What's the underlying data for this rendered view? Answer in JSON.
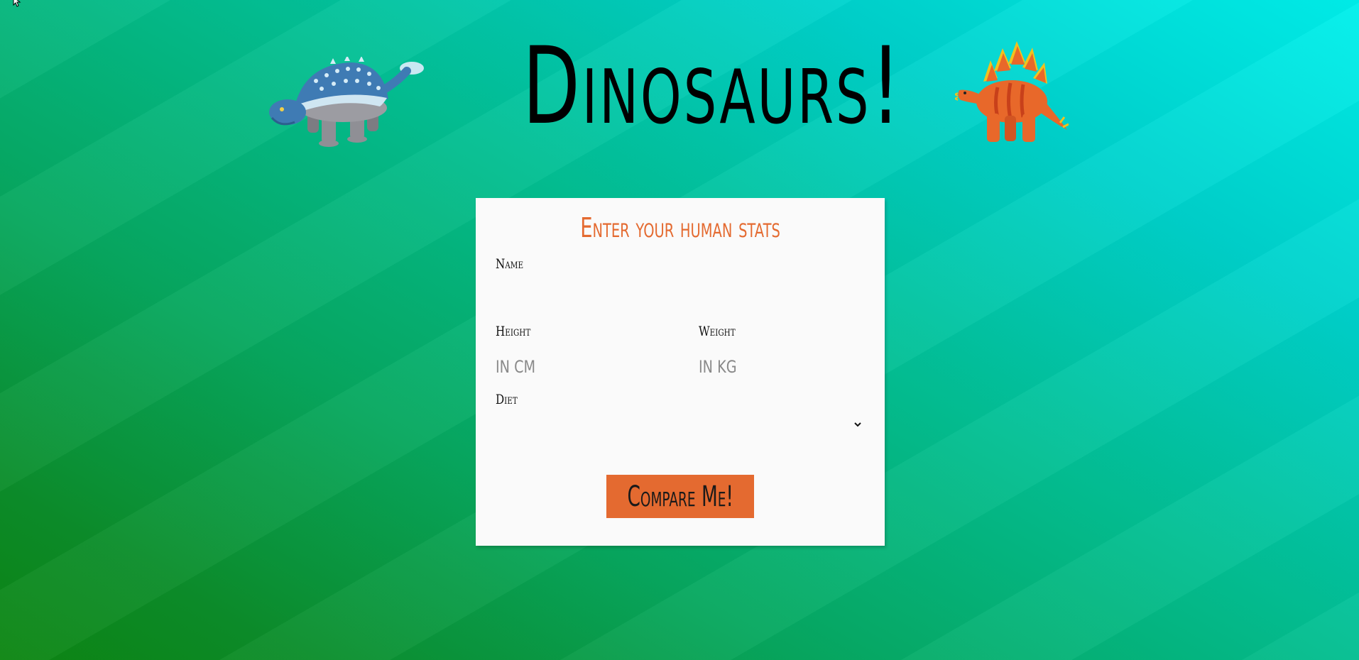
{
  "page": {
    "title": "Dinosaurs!"
  },
  "form": {
    "heading": "Enter your human stats",
    "name": {
      "label": "Name",
      "value": "",
      "placeholder": ""
    },
    "height": {
      "label": "Height",
      "value": "",
      "placeholder": "IN CM"
    },
    "weight": {
      "label": "Weight",
      "value": "",
      "placeholder": "IN KG"
    },
    "diet": {
      "label": "Diet",
      "selected": ""
    },
    "submit_label": "Compare Me!"
  },
  "icons": {
    "left_dinosaur": "ankylosaurus-icon",
    "right_dinosaur": "stegosaurus-icon",
    "select_arrow": "chevron-down-icon",
    "cursor": "mouse-cursor-icon"
  },
  "colors": {
    "accent": "#e46a30",
    "card_background": "#fafafa",
    "title_text": "#000000",
    "background_top_right": "#00f0ec",
    "background_bottom_left": "#0d8612"
  }
}
